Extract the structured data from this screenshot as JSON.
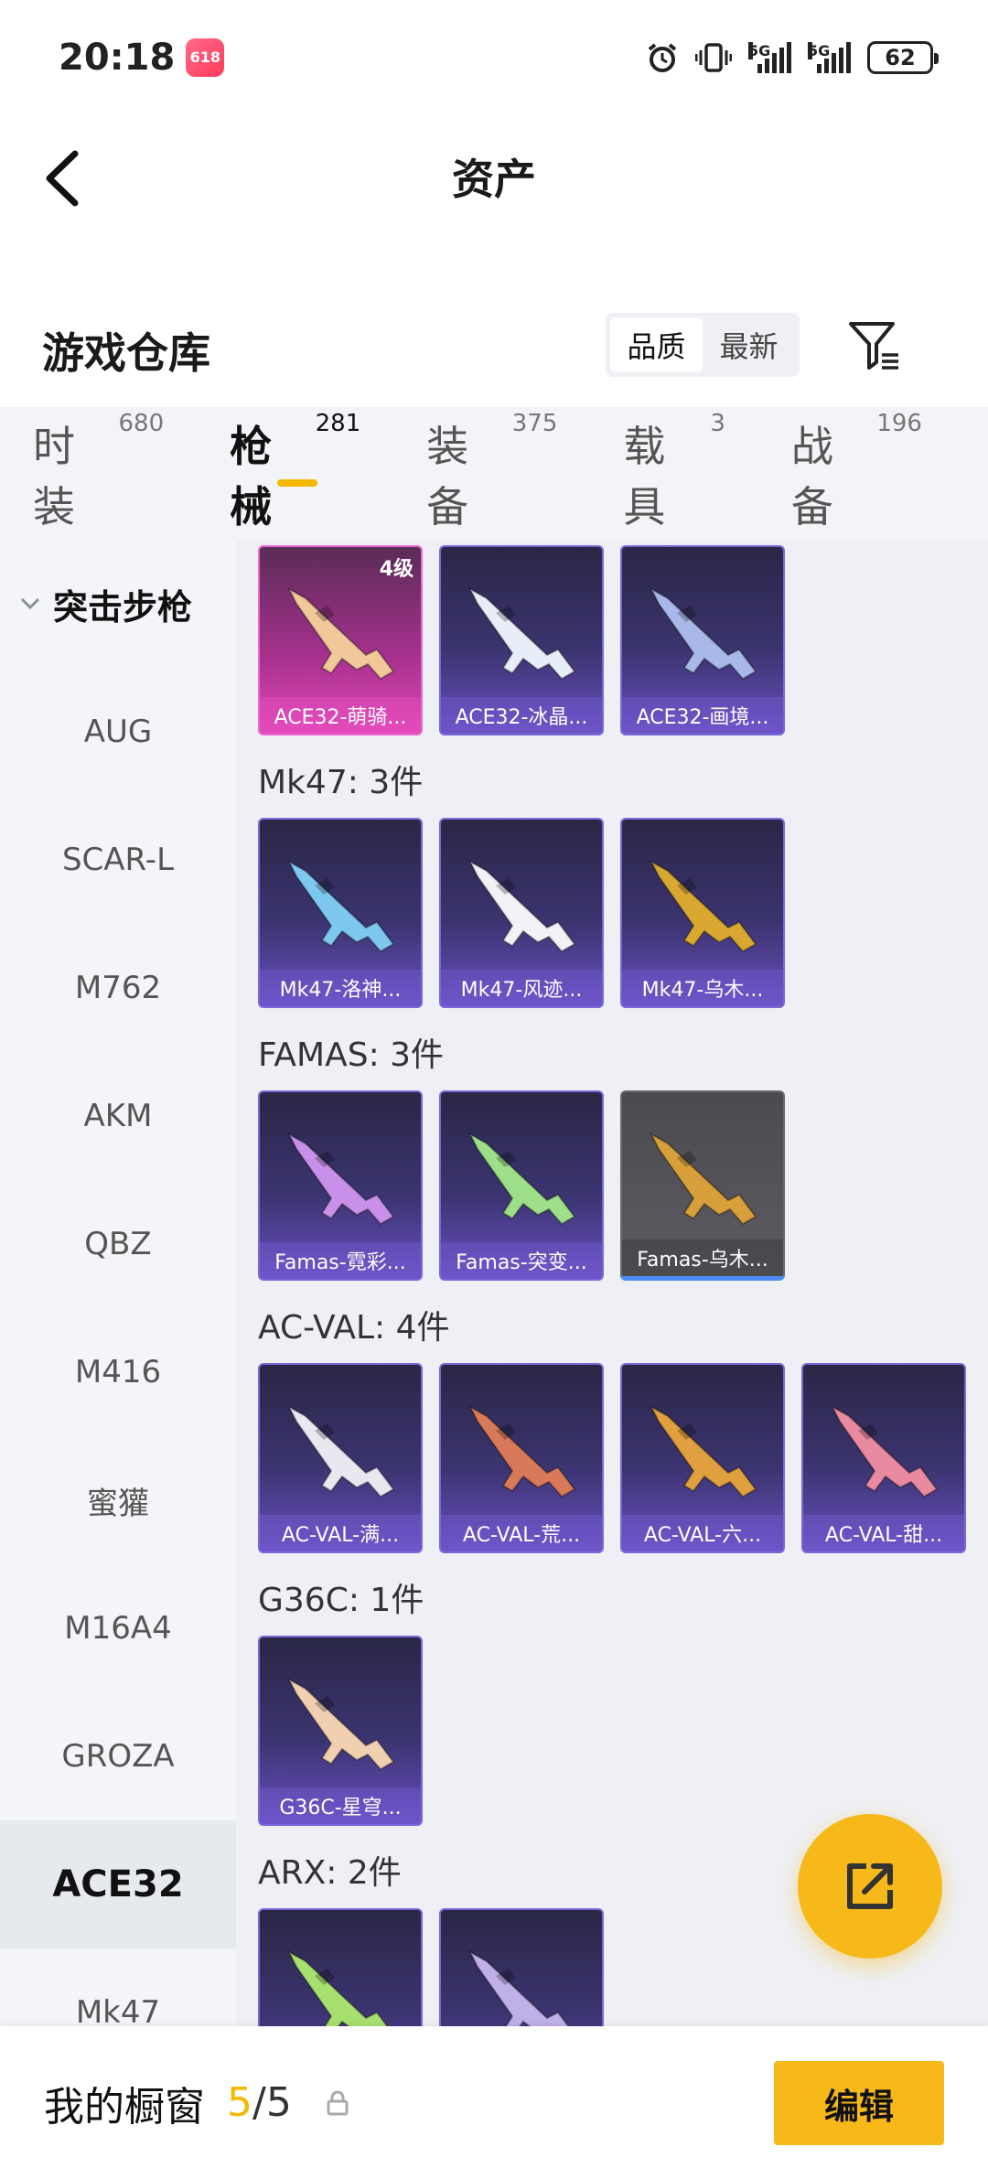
{
  "status_bar": {
    "time": "20:18",
    "app_badge": "618",
    "network_1": "5G",
    "network_2": "5G",
    "battery": "62"
  },
  "header": {
    "title": "资产"
  },
  "warehouse": {
    "title": "游戏仓库",
    "sort_options": [
      "品质",
      "最新"
    ],
    "active_sort": "品质"
  },
  "tabs": [
    {
      "label": "时装",
      "count": "680"
    },
    {
      "label": "枪械",
      "count": "281"
    },
    {
      "label": "装备",
      "count": "375"
    },
    {
      "label": "载具",
      "count": "3"
    },
    {
      "label": "战备",
      "count": "196"
    }
  ],
  "active_tab": "枪械",
  "sidebar": {
    "group": "突击步枪",
    "items": [
      "AUG",
      "SCAR-L",
      "M762",
      "AKM",
      "QBZ",
      "M416",
      "蜜獾",
      "M16A4",
      "GROZA",
      "ACE32",
      "Mk47"
    ],
    "active_item": "ACE32"
  },
  "groups": [
    {
      "title": "",
      "items": [
        {
          "name": "ACE32-萌骑...",
          "level": "4级",
          "style": "pink",
          "gun_color": "#f0c89a"
        },
        {
          "name": "ACE32-冰晶...",
          "level": "",
          "style": "purple",
          "gun_color": "#e8eef8"
        },
        {
          "name": "ACE32-画境...",
          "level": "",
          "style": "purple",
          "gun_color": "#a8b8e8"
        }
      ]
    },
    {
      "title": "Mk47: 3件",
      "items": [
        {
          "name": "Mk47-洛神...",
          "level": "",
          "style": "purple",
          "gun_color": "#7ec8f0"
        },
        {
          "name": "Mk47-风迹...",
          "level": "",
          "style": "purple",
          "gun_color": "#f2f2f6"
        },
        {
          "name": "Mk47-乌木...",
          "level": "",
          "style": "purple",
          "gun_color": "#d8a830"
        }
      ]
    },
    {
      "title": "FAMAS: 3件",
      "items": [
        {
          "name": "Famas-霓彩...",
          "level": "",
          "style": "purple",
          "gun_color": "#c890e8"
        },
        {
          "name": "Famas-突变...",
          "level": "",
          "style": "purple",
          "gun_color": "#9ee08a"
        },
        {
          "name": "Famas-乌木...",
          "level": "",
          "style": "gray",
          "gun_color": "#d8a03a"
        }
      ]
    },
    {
      "title": "AC-VAL: 4件",
      "items": [
        {
          "name": "AC-VAL-满...",
          "level": "",
          "style": "purple",
          "gun_color": "#e8e8f0"
        },
        {
          "name": "AC-VAL-荒...",
          "level": "",
          "style": "purple",
          "gun_color": "#d87a5a"
        },
        {
          "name": "AC-VAL-六...",
          "level": "",
          "style": "purple",
          "gun_color": "#e0a040"
        },
        {
          "name": "AC-VAL-甜...",
          "level": "",
          "style": "purple",
          "gun_color": "#e88aa0"
        }
      ]
    },
    {
      "title": "G36C: 1件",
      "items": [
        {
          "name": "G36C-星穹...",
          "level": "",
          "style": "purple",
          "gun_color": "#f0d0b0"
        }
      ]
    },
    {
      "title": "ARX: 2件",
      "items": [
        {
          "name": "",
          "level": "",
          "style": "purple",
          "gun_color": "#a8e070"
        },
        {
          "name": "",
          "level": "",
          "style": "purple",
          "gun_color": "#c0b0e8"
        }
      ]
    }
  ],
  "bottom_bar": {
    "label": "我的橱窗",
    "current": "5",
    "separator": "/",
    "max": "5",
    "edit_label": "编辑"
  },
  "colors": {
    "accent": "#f7b81a",
    "card_purple": "#3b3470",
    "card_pink": "#e247b8"
  }
}
